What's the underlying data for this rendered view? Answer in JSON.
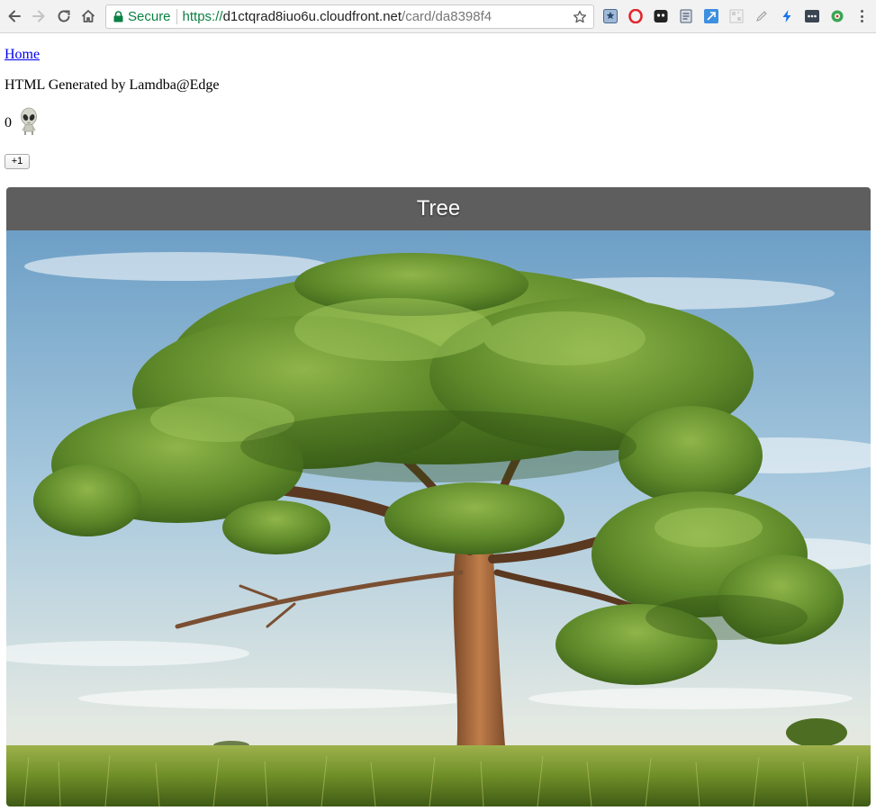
{
  "browser": {
    "security_label": "Secure",
    "url_scheme": "https://",
    "url_host": "d1ctqrad8iuo6u.cloudfront.net",
    "url_path": "/card/da8398f4",
    "buttons": [
      "back-icon",
      "forward-icon",
      "reload-icon",
      "home-icon",
      "bookmark-star-icon",
      "menu-kebab-icon"
    ],
    "extensions": [
      "bookmark-manager-icon",
      "opera-icon",
      "ghostery-icon",
      "page-info-icon",
      "expand-icon",
      "qr-code-icon",
      "pen-icon",
      "lightning-icon",
      "more-dots-icon",
      "tracker-icon"
    ],
    "colors": {
      "secure": "#0b8043",
      "omnibox_border": "#c9c9c9",
      "toolbar_bg": "#f2f2f2"
    }
  },
  "page": {
    "home_link": "Home",
    "generated_text": "HTML Generated by Lamdba@Edge",
    "counter_value": "0",
    "counter_icon": "alien-icon",
    "plus_button": "+1",
    "card": {
      "title": "Tree",
      "image": "tree-photo",
      "header_color": "#5e5e5e"
    }
  }
}
